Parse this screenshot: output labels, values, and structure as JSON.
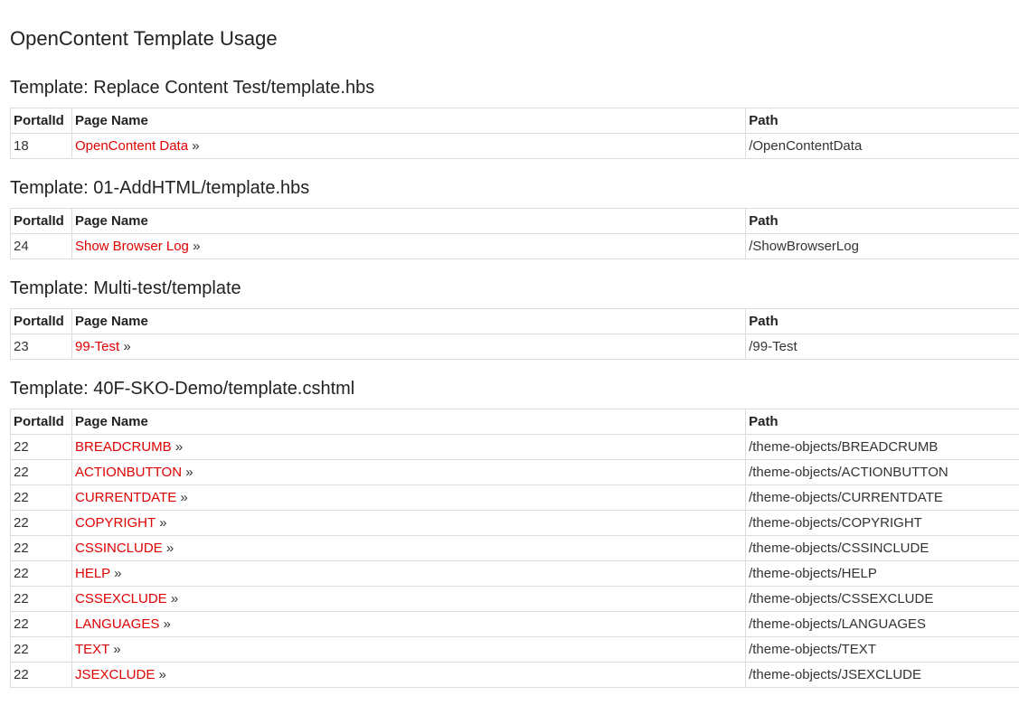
{
  "page_title": "OpenContent Template Usage",
  "colors": {
    "link": "#e00000",
    "border": "#dddddd",
    "text": "#222222"
  },
  "columns": {
    "portal": "PortalId",
    "page": "Page Name",
    "path": "Path"
  },
  "link_suffix": "»",
  "sections": [
    {
      "title": "Template: Replace Content Test/template.hbs",
      "rows": [
        {
          "portal_id": "18",
          "page_name": "OpenContent Data",
          "path": "/OpenContentData"
        }
      ]
    },
    {
      "title": "Template: 01-AddHTML/template.hbs",
      "rows": [
        {
          "portal_id": "24",
          "page_name": "Show Browser Log",
          "path": "/ShowBrowserLog"
        }
      ]
    },
    {
      "title": "Template: Multi-test/template",
      "rows": [
        {
          "portal_id": "23",
          "page_name": "99-Test",
          "path": "/99-Test"
        }
      ]
    },
    {
      "title": "Template: 40F-SKO-Demo/template.cshtml",
      "rows": [
        {
          "portal_id": "22",
          "page_name": "BREADCRUMB",
          "path": "/theme-objects/BREADCRUMB"
        },
        {
          "portal_id": "22",
          "page_name": "ACTIONBUTTON",
          "path": "/theme-objects/ACTIONBUTTON"
        },
        {
          "portal_id": "22",
          "page_name": "CURRENTDATE",
          "path": "/theme-objects/CURRENTDATE"
        },
        {
          "portal_id": "22",
          "page_name": "COPYRIGHT",
          "path": "/theme-objects/COPYRIGHT"
        },
        {
          "portal_id": "22",
          "page_name": "CSSINCLUDE",
          "path": "/theme-objects/CSSINCLUDE"
        },
        {
          "portal_id": "22",
          "page_name": "HELP",
          "path": "/theme-objects/HELP"
        },
        {
          "portal_id": "22",
          "page_name": "CSSEXCLUDE",
          "path": "/theme-objects/CSSEXCLUDE"
        },
        {
          "portal_id": "22",
          "page_name": "LANGUAGES",
          "path": "/theme-objects/LANGUAGES"
        },
        {
          "portal_id": "22",
          "page_name": "TEXT",
          "path": "/theme-objects/TEXT"
        },
        {
          "portal_id": "22",
          "page_name": "JSEXCLUDE",
          "path": "/theme-objects/JSEXCLUDE"
        }
      ]
    }
  ]
}
